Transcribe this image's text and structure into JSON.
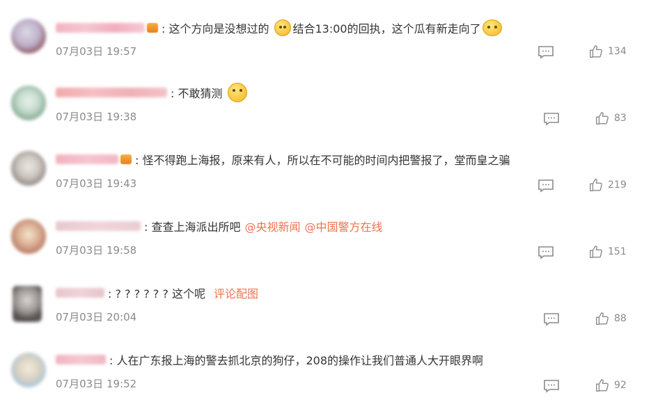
{
  "comments": [
    {
      "time": "07月03日 19:57",
      "text_parts": [
        ": 这个方向是没想过的",
        "结合13:00的回执，这个瓜有新走向了"
      ],
      "likes": "134",
      "mentions": []
    },
    {
      "time": "07月03日 19:38",
      "text_parts": ": 不敢猜测",
      "likes": "83",
      "mentions": []
    },
    {
      "time": "07月03日 19:43",
      "text_parts": ": 怪不得跑上海报，原来有人，所以在不可能的时间内把警报了，堂而皇之骗",
      "likes": "219",
      "mentions": []
    },
    {
      "time": "07月03日 19:58",
      "text_parts": ": 查查上海派出所吧",
      "likes": "151",
      "mentions": [
        "@央视新闻",
        "@中国警方在线"
      ]
    },
    {
      "time": "07月03日 20:04",
      "text_parts": ": ? ? ? ? ? ?  这个呢",
      "likes": "88",
      "mentions": [
        "评论配图"
      ]
    },
    {
      "time": "07月03日 19:52",
      "text_parts": ": 人在广东报上海的警去抓北京的狗仔，208的操作让我们普通人大开眼界啊",
      "likes": "92",
      "mentions": []
    }
  ],
  "colors": {
    "link": "#eb7350",
    "meta": "#8a8a8a",
    "text": "#333333"
  },
  "icons": {
    "comment": "comment-icon",
    "like": "thumbs-up-icon",
    "emoji": "emoji-icon",
    "badge": "crown-badge-icon"
  }
}
